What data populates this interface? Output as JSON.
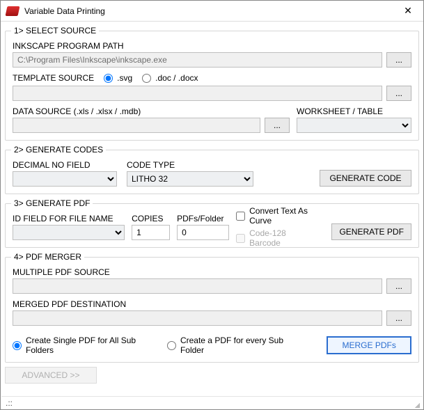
{
  "window": {
    "title": "Variable Data Printing",
    "close_glyph": "✕"
  },
  "section1": {
    "legend": "1> SELECT SOURCE",
    "inkscape_label": "INKSCAPE PROGRAM PATH",
    "inkscape_path": "C:\\Program Files\\Inkscape\\inkscape.exe",
    "template_label": "TEMPLATE SOURCE",
    "radio_svg": ".svg",
    "radio_doc": ".doc / .docx",
    "template_value": "",
    "data_label": "DATA SOURCE (.xls / .xlsx / .mdb)",
    "data_value": "",
    "worksheet_label": "WORKSHEET / TABLE",
    "worksheet_value": "",
    "browse": "..."
  },
  "section2": {
    "legend": "2> GENERATE CODES",
    "decimal_label": "DECIMAL NO FIELD",
    "decimal_value": "",
    "codetype_label": "CODE TYPE",
    "codetype_value": "LITHO 32",
    "generate_code": "GENERATE CODE"
  },
  "section3": {
    "legend": "3> GENERATE PDF",
    "idfield_label": "ID FIELD FOR FILE NAME",
    "idfield_value": "",
    "copies_label": "COPIES",
    "copies_value": "1",
    "pdfs_label": "PDFs/Folder",
    "pdfs_value": "0",
    "convert_label": "Convert Text As Curve",
    "code128_label": "Code-128 Barcode",
    "generate_pdf": "GENERATE PDF"
  },
  "section4": {
    "legend": "4> PDF MERGER",
    "multiple_label": "MULTIPLE PDF SOURCE",
    "multiple_value": "",
    "merged_label": "MERGED PDF DESTINATION",
    "merged_value": "",
    "radio_single": "Create Single PDF for All Sub Folders",
    "radio_every": "Create a PDF for every Sub Folder",
    "merge_btn": "MERGE PDFs",
    "browse": "..."
  },
  "footer": {
    "advanced": "ADVANCED >>",
    "status": ".::"
  }
}
